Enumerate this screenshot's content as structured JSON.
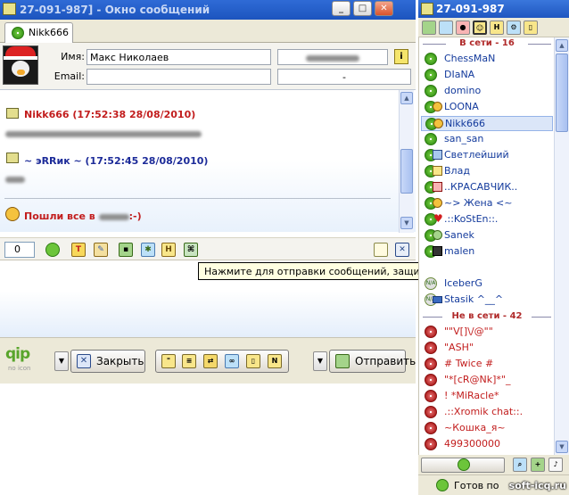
{
  "chat_window": {
    "title": "27-091-987] - Окно сообщений",
    "tab_label": "Nikk666",
    "user_info": {
      "name_label": "Имя:",
      "name_value": "Макс Николаев",
      "email_label": "Email:",
      "email_value": "-"
    },
    "messages": [
      {
        "header": "Nikk666 (17:52:38 28/08/2010)",
        "color": "#c21d1d"
      },
      {
        "header": "~ эRRик ~ (17:52:45 28/08/2010)",
        "color": "#1c2b99"
      }
    ],
    "outgoing_partial": {
      "prefix": "Пошли все в ",
      "suffix": ":-)"
    },
    "toolbar": {
      "counter": "0"
    },
    "tooltip": "Нажмите для отправки сообщений, защищённых паролем (если ваш собеседник име",
    "bottom": {
      "logo": "qip",
      "logo_sub": "no icon",
      "close_label": "Закрыть",
      "send_label": "Отправить",
      "group_icons": [
        "quote-icon",
        "template-icon",
        "translit-icon",
        "link-icon",
        "file-icon",
        "n-icon"
      ]
    }
  },
  "contact_list": {
    "title": "27-091-987",
    "online_group": "В сети - 16",
    "offline_group": "Не в сети - 42",
    "online_contacts": [
      {
        "name": "ChessMaN",
        "icon": "online-icon"
      },
      {
        "name": "DIaNA",
        "icon": "online-icon"
      },
      {
        "name": "domino",
        "icon": "online-icon"
      },
      {
        "name": "LOONA",
        "icon": "online-icon"
      },
      {
        "name": "Nikk666",
        "icon": "online-icon",
        "selected": true
      },
      {
        "name": "san_san",
        "icon": "online-icon"
      },
      {
        "name": "Светлейший",
        "icon": "online-icon"
      },
      {
        "name": "Влад",
        "icon": "online-icon"
      },
      {
        "name": "..КРАСАВЧИК..",
        "icon": "online-icon"
      },
      {
        "name": "~> Жена <~",
        "icon": "online-icon"
      },
      {
        "name": ".::KoStEn::.",
        "icon": "online-icon"
      },
      {
        "name": "Sanek",
        "icon": "online-icon"
      },
      {
        "name": "malen",
        "icon": "online-icon"
      },
      {
        "name": "IceberG",
        "icon": "na-icon"
      },
      {
        "name": "Stasik ^__^",
        "icon": "na-icon"
      }
    ],
    "offline_contacts": [
      {
        "name": "\"\"V[]\\/@\"\""
      },
      {
        "name": "\"ASH\""
      },
      {
        "name": "# Twice #"
      },
      {
        "name": "\"*[cR@Nk]*\"_"
      },
      {
        "name": "! *MiRacle*"
      },
      {
        "name": ".::Xromik chat::."
      },
      {
        "name": "~Кошка_я~"
      },
      {
        "name": "499300000"
      }
    ],
    "status_text": "Готов по",
    "watermark": "soft-icq.ru"
  },
  "colors": {
    "online_text": "#133a9c",
    "offline_text": "#c21d1d",
    "group_header": "#b02a2a",
    "title_bar": "#2160cc"
  }
}
